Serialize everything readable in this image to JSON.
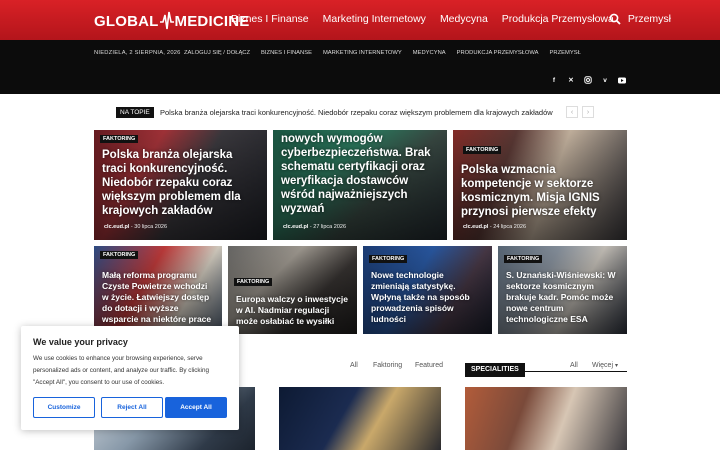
{
  "header": {
    "logo_left": "GLOBAL",
    "logo_right": "MEDICINE",
    "nav": [
      "Biznes I Finanse",
      "Marketing Internetowy",
      "Medycyna",
      "Produkcja Przemysłowa",
      "Przemysł"
    ]
  },
  "topbar": {
    "date": "NIEDZIELA, 2 SIERPNIA, 2026",
    "links": [
      "ZALOGUJ SIĘ / DOŁĄCZ",
      "BIZNES I FINANSE",
      "MARKETING INTERNETOWY",
      "MEDYCYNA",
      "PRODUKCJA PRZEMYSŁOWA",
      "PRZEMYSŁ"
    ],
    "socials": [
      "facebook-icon",
      "x-icon",
      "instagram-icon",
      "vimeo-icon",
      "youtube-icon"
    ]
  },
  "ticker": {
    "label": "NA TOPIE",
    "text": "Polska branża olejarska traci konkurencyjność. Niedobór rzepaku coraz większym problemem dla krajowych zakładów",
    "prev": "‹",
    "next": "›"
  },
  "big_tiles": [
    {
      "tag": "FAKTORING",
      "title": "Polska branża olejarska traci konkurencyjność. Niedobór rzepaku coraz większym problemem dla krajowych zakładów",
      "author": "clc.eud.pl",
      "sep": "-",
      "date": "30 lipca 2026"
    },
    {
      "tag": "",
      "title": "nowych wymogów cyberbezpieczeństwa. Brak schematu certyfikacji oraz weryfikacja dostawców wśród najważniejszych wyzwań",
      "author": "clc.eud.pl",
      "sep": "-",
      "date": "27 lipca 2026"
    },
    {
      "tag": "FAKTORING",
      "title": "Polska wzmacnia kompetencje w sektorze kosmicznym. Misja IGNIS przynosi pierwsze efekty",
      "author": "clc.eud.pl",
      "sep": "-",
      "date": "24 lipca 2026"
    }
  ],
  "small_tiles": [
    {
      "tag": "FAKTORING",
      "title": "Małą reforma programu Czyste Powietrze wchodzi w życie. Łatwiejszy dostęp do dotacji i wyższe wsparcie na niektóre prace"
    },
    {
      "tag": "FAKTORING",
      "title": "Europa walczy o inwestycje w AI. Nadmiar regulacji może osłabiać te wysiłki"
    },
    {
      "tag": "FAKTORING",
      "title": "Nowe technologie zmieniają statystykę. Wpłyną także na sposób prowadzenia spisów ludności"
    },
    {
      "tag": "FAKTORING",
      "title": "S. Uznański-Wiśniewski: W sektorze kosmicznym brakuje kadr. Pomóc może nowe centrum technologiczne ESA"
    }
  ],
  "filters": {
    "all": "All",
    "faktoring": "Faktoring",
    "featured": "Featured"
  },
  "specialities": {
    "title": "SPECIALITIES",
    "all": "All",
    "more": "Więcej"
  },
  "cookie": {
    "title": "We value your privacy",
    "text": "We use cookies to enhance your browsing experience, serve personalized ads or content, and analyze our traffic. By clicking \"Accept All\", you consent to our use of cookies.",
    "customize": "Customize",
    "reject": "Reject All",
    "accept": "Accept All"
  },
  "colors": {
    "brand_red": "#d92126",
    "accent_blue": "#1863dc",
    "dark": "#0c0c0c"
  }
}
